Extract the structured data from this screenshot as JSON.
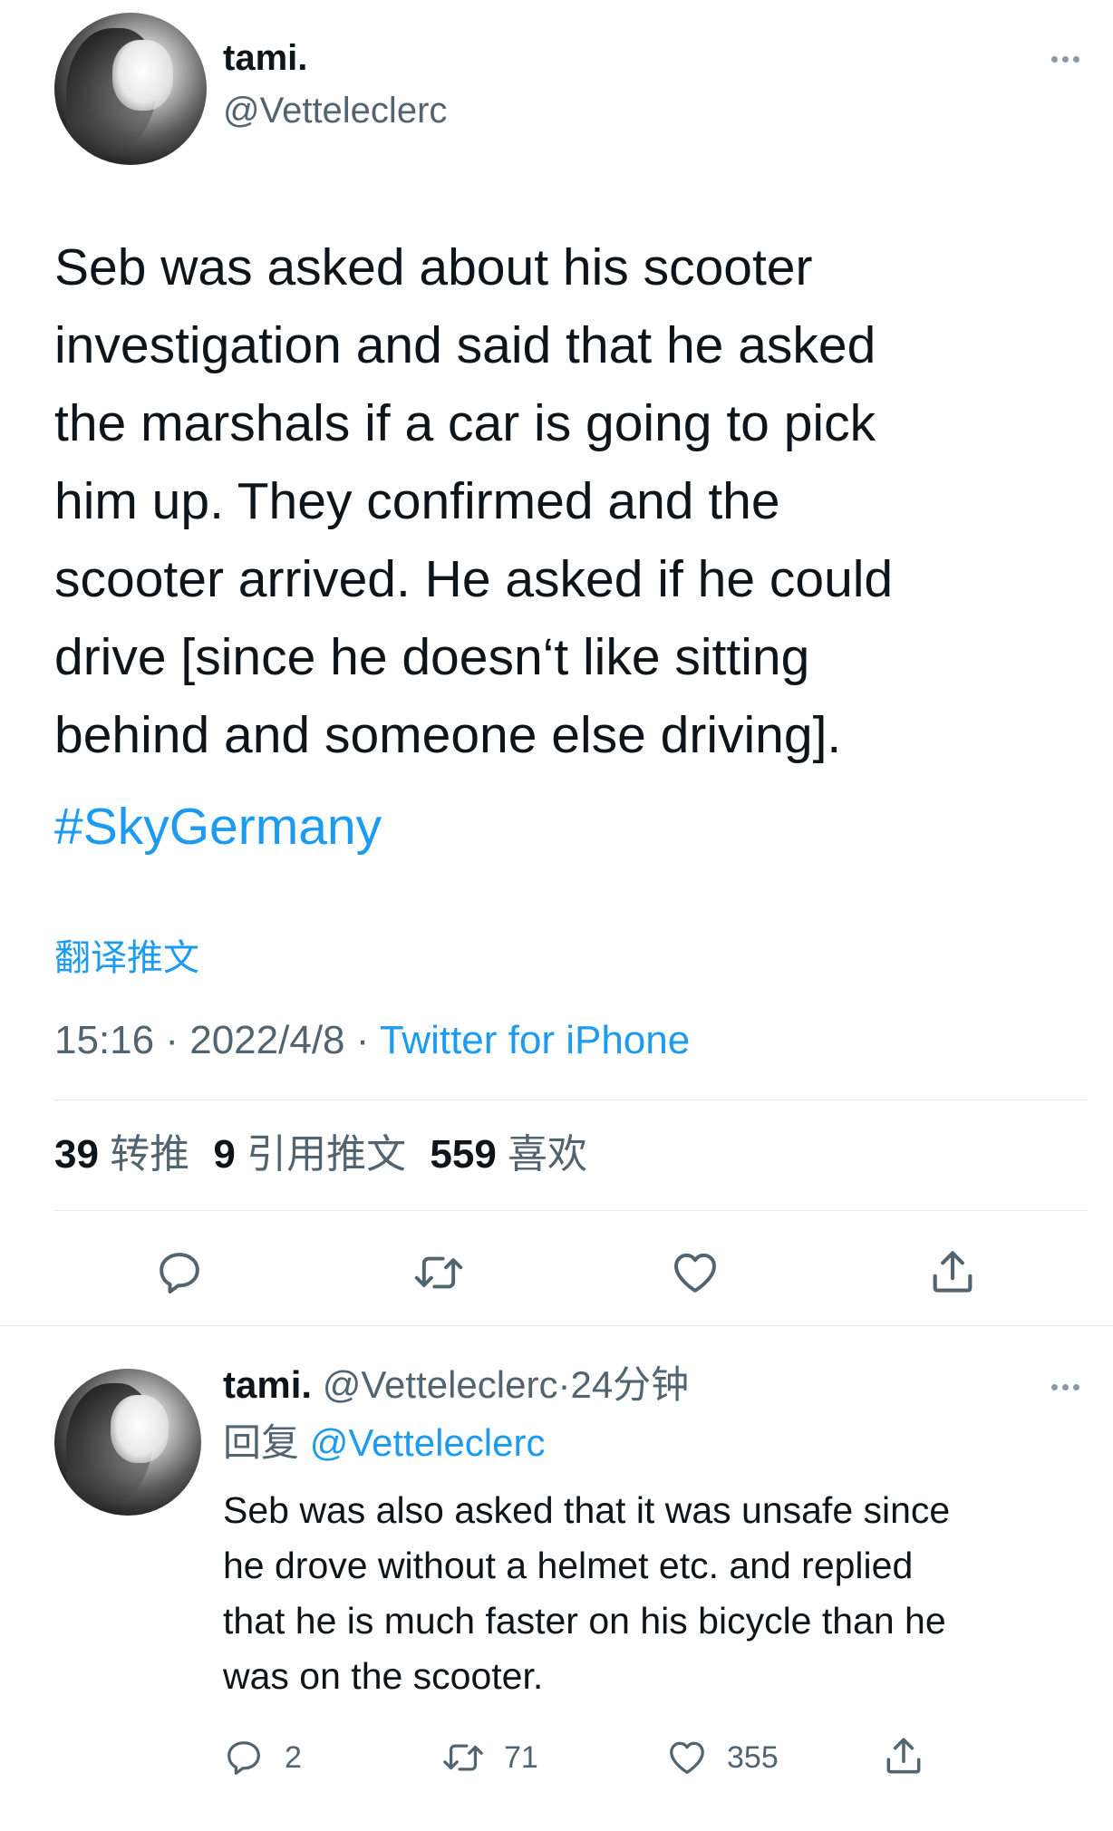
{
  "main_tweet": {
    "display_name": "tami.",
    "handle": "@Vetteleclerc",
    "text_lines": [
      "Seb was asked about his scooter",
      "investigation and said that he asked",
      "the marshals if a car is going to pick",
      "him up. They confirmed and the",
      "scooter arrived. He asked if he could",
      "drive [since he doesn‘t like sitting",
      "behind and someone else driving]."
    ],
    "hashtag": "#SkyGermany",
    "translate_label": "翻译推文",
    "time": "15:16",
    "date": "2022/4/8",
    "separator": "·",
    "source": "Twitter for iPhone",
    "stats": {
      "retweets_count": "39",
      "retweets_label": "转推",
      "quotes_count": "9",
      "quotes_label": "引用推文",
      "likes_count": "559",
      "likes_label": "喜欢"
    },
    "actions": {
      "reply_icon": "reply-icon",
      "retweet_icon": "retweet-icon",
      "like_icon": "heart-icon",
      "share_icon": "share-icon"
    }
  },
  "reply_tweet": {
    "display_name": "tami.",
    "handle": "@Vetteleclerc",
    "separator": "·",
    "time_ago": "24分钟",
    "replying_prefix": "回复",
    "replying_to": "@Vetteleclerc",
    "text_lines": [
      "Seb was also asked that it was unsafe since",
      "he drove without a helmet etc. and replied",
      "that he is much faster on his bicycle than he",
      "was on the scooter."
    ],
    "actions": {
      "reply_count": "2",
      "retweet_count": "71",
      "like_count": "355"
    }
  },
  "colors": {
    "accent": "#1d9bf0",
    "text_primary": "#0f1419",
    "text_secondary": "#536471",
    "divider": "#e6e9ec"
  }
}
